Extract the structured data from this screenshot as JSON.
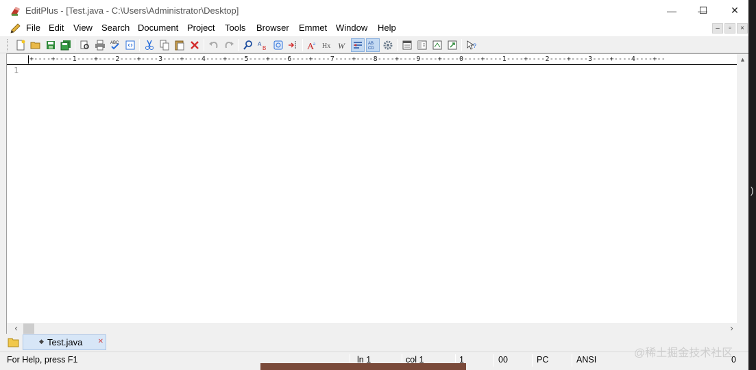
{
  "window": {
    "title": "EditPlus - [Test.java - C:\\Users\\Administrator\\Desktop]",
    "caption_minimize": "—",
    "caption_maximize": "☐",
    "caption_close": "✕"
  },
  "menu": {
    "items": [
      "File",
      "Edit",
      "View",
      "Search",
      "Document",
      "Project",
      "Tools",
      "Browser",
      "Emmet",
      "Window",
      "Help"
    ]
  },
  "mdi": {
    "minimize": "–",
    "restore": "▫",
    "close": "×"
  },
  "toolbar": {
    "buttons": [
      "new-file",
      "open-file",
      "save",
      "save-all",
      "print-preview",
      "print",
      "spell-check",
      "browser-view",
      "cut",
      "copy",
      "paste",
      "delete",
      "undo",
      "redo",
      "find",
      "replace",
      "find-in-files",
      "go-to-line",
      "font",
      "hex-viewer",
      "word-wrap",
      "line-numbers",
      "column-select",
      "preferences",
      "output-window",
      "directory-window",
      "cliptext-window",
      "sync-browser",
      "context-help"
    ],
    "active": [
      "word-wrap",
      "column-select"
    ]
  },
  "ruler": {
    "text": "+----+----1----+----2----+----3----+----4----+----5----+----6----+----7----+----8----+----9----+----0----+----1----+----2----+----3----+----4----+--"
  },
  "editor": {
    "line_numbers": [
      "1"
    ]
  },
  "tabs": [
    {
      "label": "Test.java",
      "modified_marker": "◆",
      "close": "✕"
    }
  ],
  "status": {
    "help": "For Help, press F1",
    "line": "ln 1",
    "col": "col 1",
    "sel": "1",
    "code": "00",
    "eol": "PC",
    "encoding": "ANSI",
    "count": "0"
  },
  "watermark": "@稀土掘金技术社区",
  "colors": {
    "accent_tab": "#d7e6f7",
    "toolbar_active": "#c3d9f2",
    "line_number": "#999999"
  }
}
